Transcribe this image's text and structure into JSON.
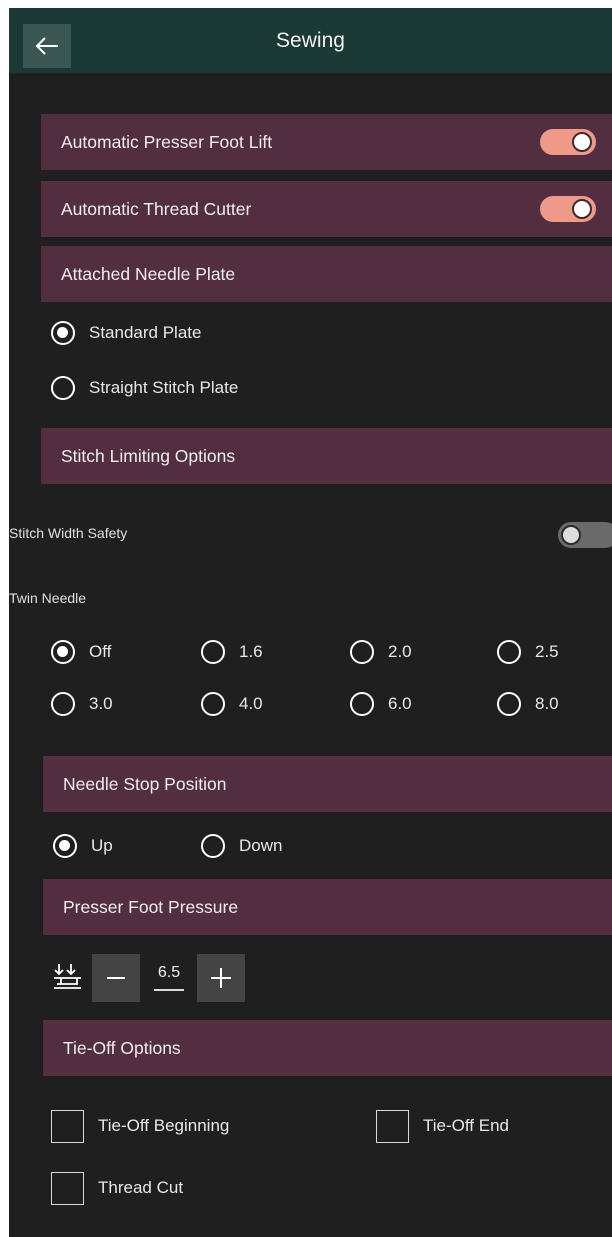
{
  "header": {
    "title": "Sewing",
    "back_icon": "arrow-left-icon"
  },
  "settings": {
    "presser_foot_lift": {
      "label": "Automatic Presser Foot Lift",
      "on": true
    },
    "thread_cutter": {
      "label": "Automatic Thread Cutter",
      "on": true
    }
  },
  "needle_plate": {
    "title": "Attached Needle Plate",
    "options": [
      "Standard Plate",
      "Straight Stitch Plate"
    ],
    "selected": "Standard Plate"
  },
  "stitch_limiting": {
    "title": "Stitch Limiting Options",
    "width_safety": {
      "label": "Stitch Width Safety",
      "on": false
    },
    "twin_needle": {
      "label": "Twin Needle",
      "options": [
        "Off",
        "1.6",
        "2.0",
        "2.5",
        "3.0",
        "4.0",
        "6.0",
        "8.0"
      ],
      "selected": "Off"
    }
  },
  "needle_stop": {
    "title": "Needle Stop Position",
    "options": [
      "Up",
      "Down"
    ],
    "selected": "Up"
  },
  "presser_pressure": {
    "title": "Presser Foot Pressure",
    "value": "6.5",
    "icon": "presser-foot-pressure-icon"
  },
  "tie_off": {
    "title": "Tie-Off Options",
    "options": [
      {
        "label": "Tie-Off Beginning",
        "checked": false
      },
      {
        "label": "Tie-Off End",
        "checked": false
      },
      {
        "label": "Thread Cut",
        "checked": false
      }
    ]
  },
  "colors": {
    "header_bg": "#1b3a36",
    "section_bg": "#532e40",
    "toggle_on": "#ef9a88",
    "background": "#1f1f1f"
  }
}
